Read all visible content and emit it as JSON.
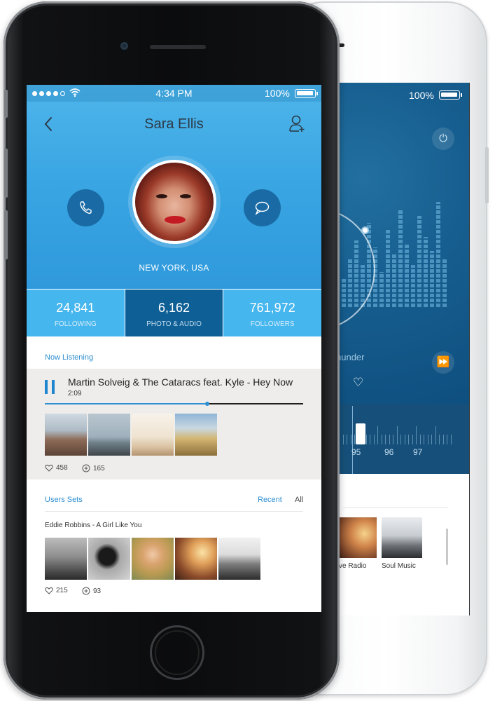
{
  "front": {
    "status_bar": {
      "time": "4:34 PM",
      "battery": "100%"
    },
    "profile": {
      "name": "Sara Ellis",
      "location": "NEW YORK, USA"
    },
    "stats": [
      {
        "value": "24,841",
        "label": "FOLLOWING",
        "active": false
      },
      {
        "value": "6,162",
        "label": "PHOTO & AUDIO",
        "active": true
      },
      {
        "value": "761,972",
        "label": "FOLLOWERS",
        "active": false
      }
    ],
    "now_listening": {
      "section_label": "Now Listening",
      "track_title": "Martin Solveig & The Cataracs feat. Kyle - Hey Now",
      "track_time": "2:09",
      "progress": 0.63,
      "likes": "458",
      "adds": "165"
    },
    "users_sets": {
      "section_label": "Users Sets",
      "tabs": {
        "recent": "Recent",
        "all": "All"
      },
      "set_title": "Eddie Robbins - A Girl Like You",
      "likes": "215",
      "adds": "93"
    }
  },
  "back": {
    "battery": "100%",
    "song_fragment": "hunder",
    "tuner_labels": [
      "95",
      "96",
      "97"
    ],
    "list_labels": [
      "ve Radio",
      "Soul Music"
    ]
  },
  "colors": {
    "accent_blue": "#2f8fd0",
    "header_blue": "#3aa6e3",
    "active_stat": "#0e5f95",
    "action_circle": "#1a6ba5"
  }
}
